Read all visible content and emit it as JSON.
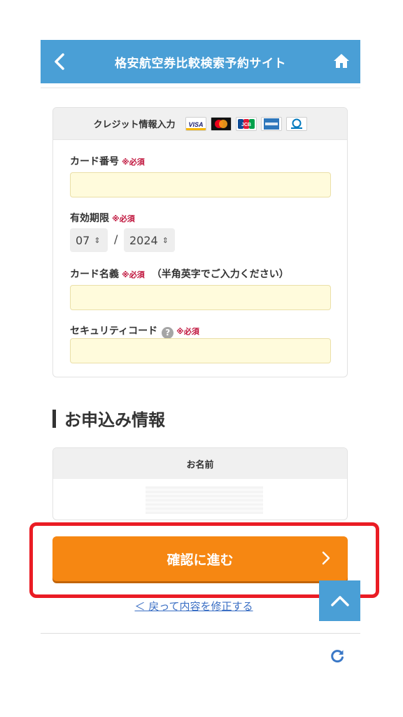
{
  "header": {
    "title": "格安航空券比較検索予約サイト",
    "back_icon": "chevron-left-icon",
    "home_icon": "home-icon",
    "bg_color": "#4a9fd6"
  },
  "credit": {
    "title": "クレジット情報入力",
    "brands": [
      "VISA",
      "mastercard",
      "JCB",
      "AMERICAN EXPRESS",
      "Diners Club"
    ],
    "card_number": {
      "label": "カード番号",
      "required": "※必須",
      "value": ""
    },
    "expiry": {
      "label": "有効期限",
      "required": "※必須",
      "month": "07",
      "year": "2024",
      "separator": "/"
    },
    "card_name": {
      "label": "カード名義",
      "required": "※必須",
      "note": "（半角英字でご入力ください）",
      "value": ""
    },
    "security": {
      "label": "セキュリティコード",
      "help": "?",
      "required": "※必須",
      "value": ""
    }
  },
  "application": {
    "section_title": "お申込み情報",
    "name_header": "お名前"
  },
  "actions": {
    "confirm_label": "確認に進む",
    "confirm_color": "#f68712",
    "highlight_color": "#ea1c24",
    "back_link": "＜ 戻って内容を修正する",
    "scroll_top_icon": "chevron-up-icon",
    "reload_icon": "reload-icon"
  }
}
